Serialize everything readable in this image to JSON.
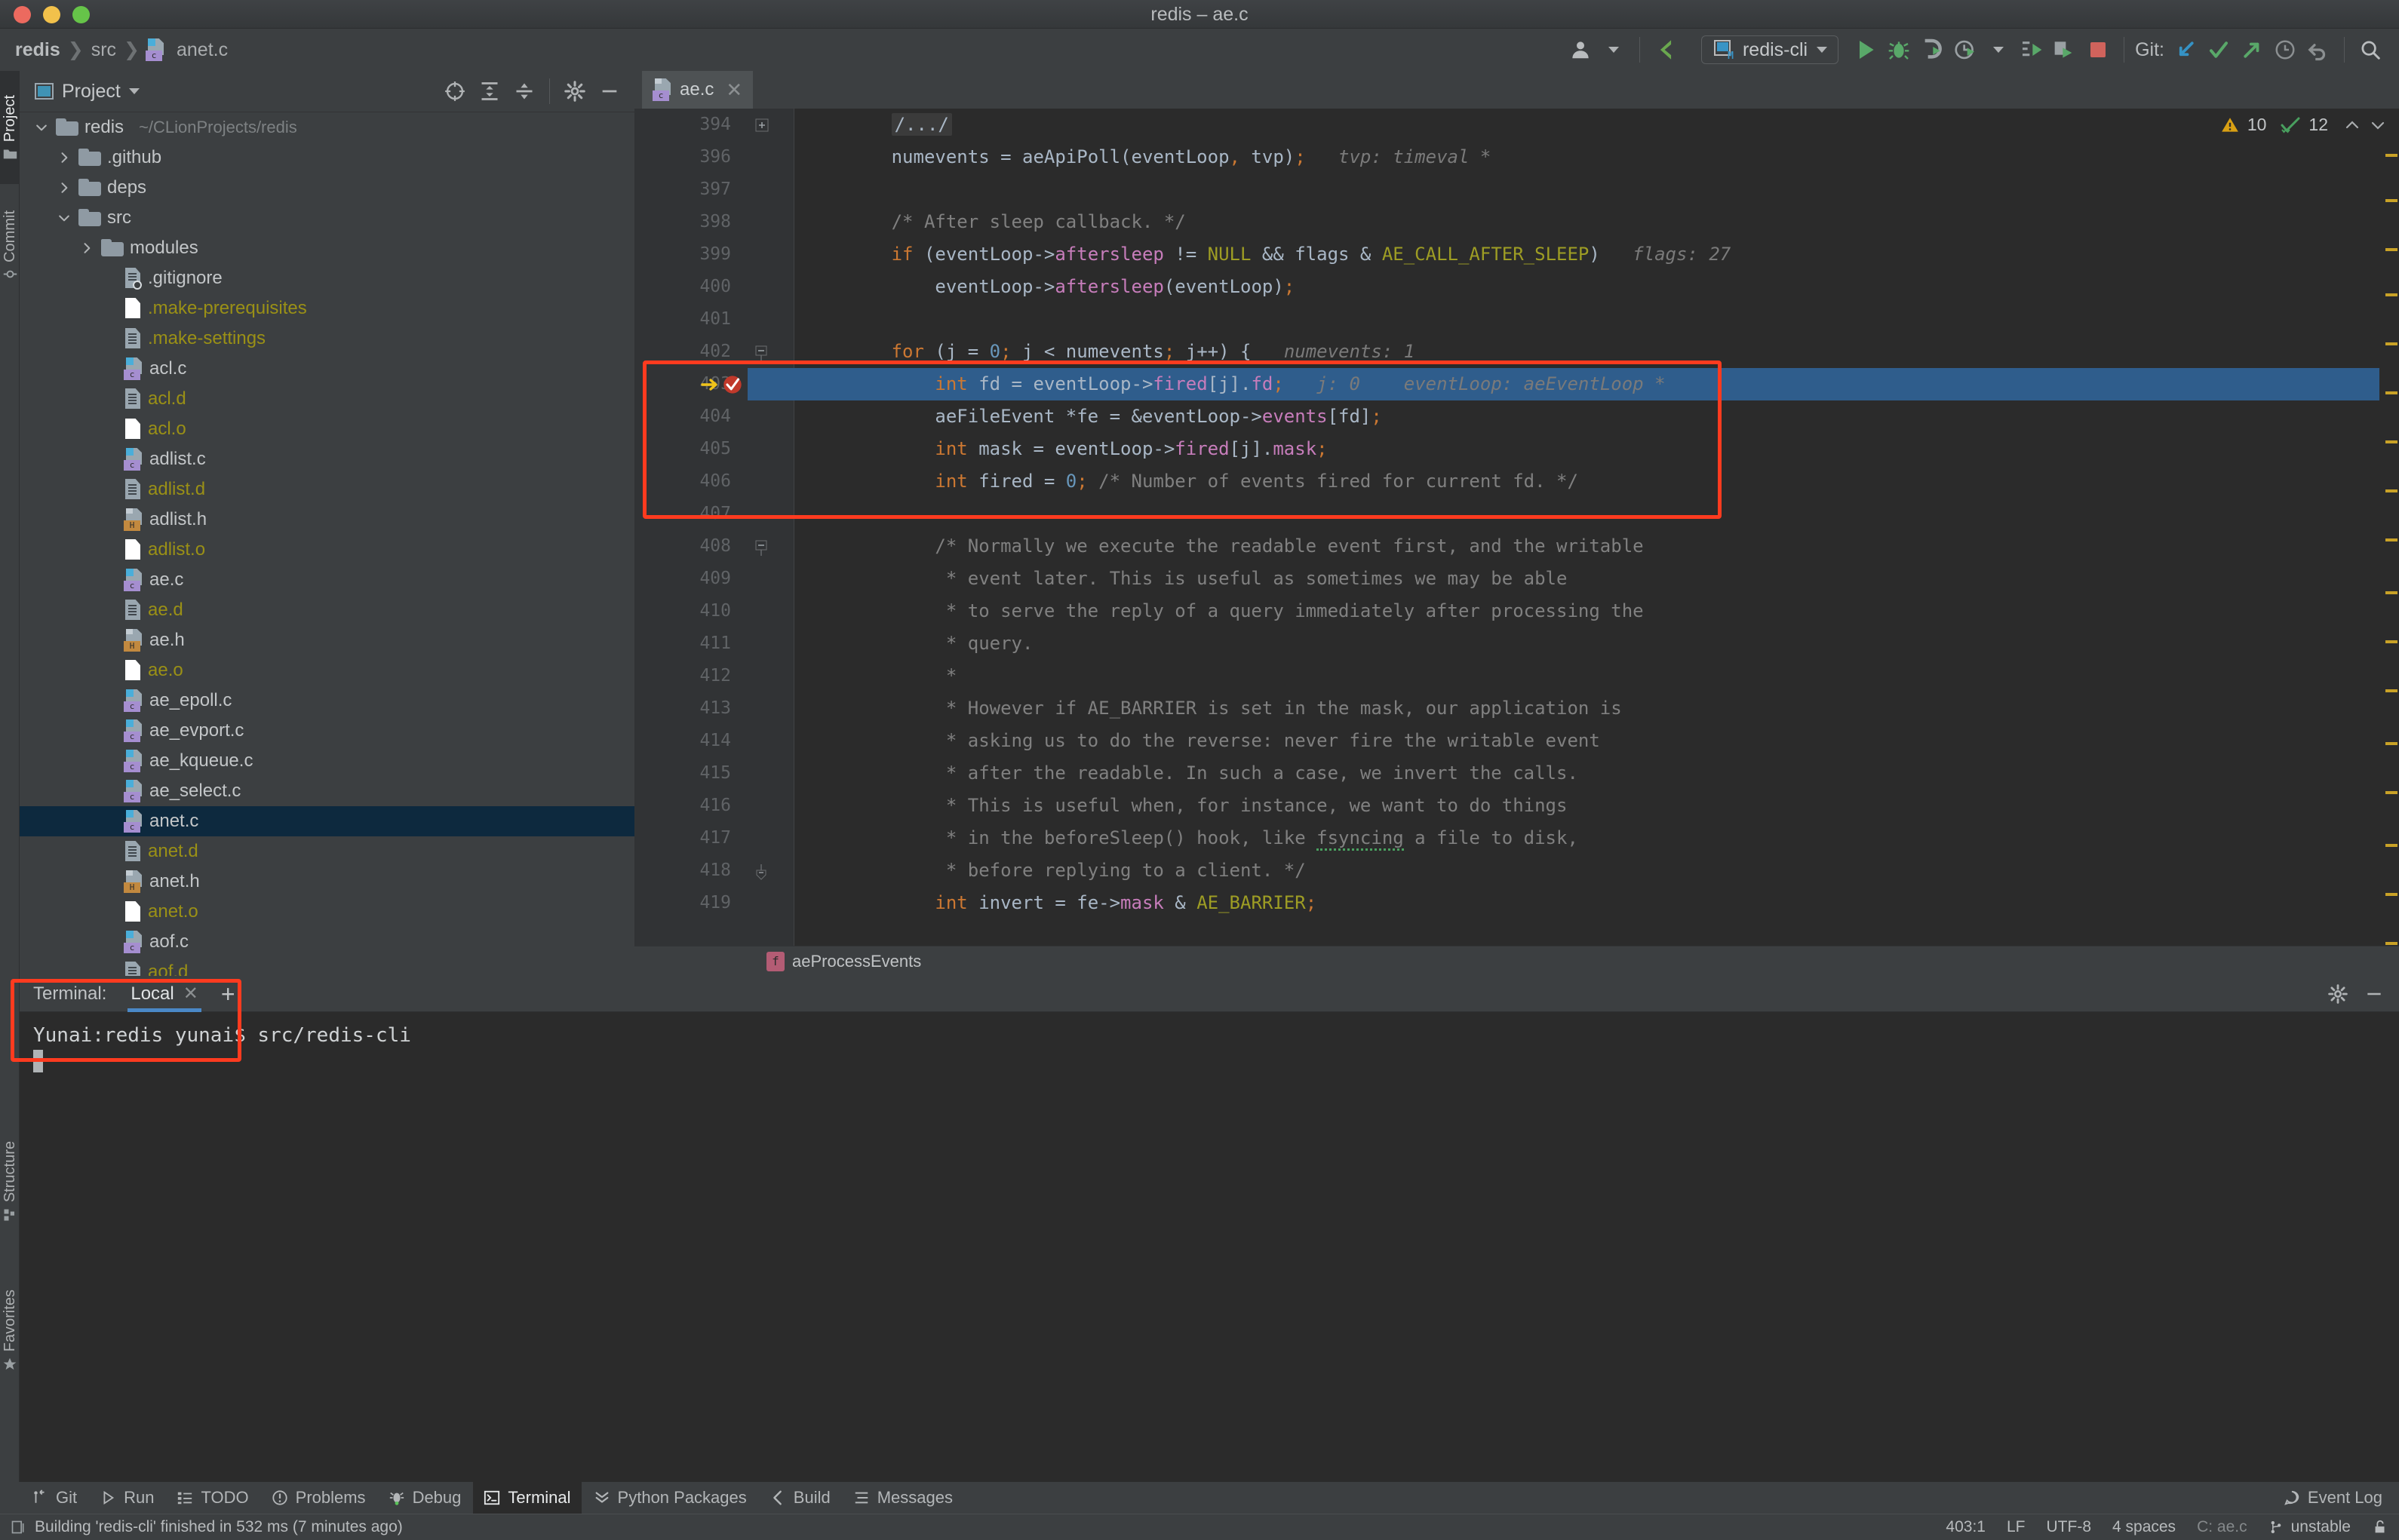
{
  "window": {
    "title": "redis – ae.c"
  },
  "breadcrumb": {
    "project": "redis",
    "folder": "src",
    "file": "anet.c",
    "separator": "❯"
  },
  "toolbar": {
    "avatar_icon": "user-avatar-icon",
    "build_icon": "build-hammer-icon",
    "run_config_label": "redis-cli",
    "run_icon": "run-play-icon",
    "debug_icon": "debug-bug-icon",
    "attach_icon": "attach-process-icon",
    "profile_icon": "profiler-clock-icon",
    "coverage_icon": "run-coverage-icon",
    "more_run_icon": "run-with-icon",
    "stop_icon": "stop-square-icon",
    "git_label": "Git:",
    "git_update_icon": "git-update-icon",
    "git_commit_icon": "git-commit-check-icon",
    "git_push_icon": "git-push-icon",
    "git_history_icon": "git-history-clock-icon",
    "git_rollback_icon": "git-rollback-icon",
    "search_icon": "search-icon"
  },
  "left_rail": {
    "top": [
      {
        "label": "Project",
        "icon": "folder-icon",
        "active": true
      },
      {
        "label": "Commit",
        "icon": "commit-icon",
        "active": false
      }
    ],
    "bottom": [
      {
        "label": "Structure",
        "icon": "structure-icon",
        "active": false
      },
      {
        "label": "Favorites",
        "icon": "star-icon",
        "active": false
      }
    ]
  },
  "project_panel": {
    "title": "Project",
    "title_icon": "project-window-icon",
    "header_icons": [
      "scroll-from-source-icon",
      "expand-all-icon",
      "collapse-all-icon",
      "settings-gear-icon",
      "hide-panel-icon"
    ],
    "tree": [
      {
        "label": "redis",
        "path": "~/CLionProjects/redis",
        "icon": "folder-icon",
        "indent": 0,
        "arrow": "down",
        "selected": false,
        "ignored": false
      },
      {
        "label": ".github",
        "path": "",
        "icon": "folder-icon",
        "indent": 1,
        "arrow": "right",
        "selected": false,
        "ignored": false
      },
      {
        "label": "deps",
        "path": "",
        "icon": "folder-icon",
        "indent": 1,
        "arrow": "right",
        "selected": false,
        "ignored": false
      },
      {
        "label": "src",
        "path": "",
        "icon": "folder-icon",
        "indent": 1,
        "arrow": "down",
        "selected": false,
        "ignored": false
      },
      {
        "label": "modules",
        "path": "",
        "icon": "folder-icon",
        "indent": 2,
        "arrow": "right",
        "selected": false,
        "ignored": false
      },
      {
        "label": ".gitignore",
        "path": "",
        "icon": "gitignore-icon",
        "indent": 3,
        "arrow": "none",
        "selected": false,
        "ignored": false
      },
      {
        "label": ".make-prerequisites",
        "path": "",
        "icon": "plain-file-icon",
        "indent": 3,
        "arrow": "none",
        "selected": false,
        "ignored": true
      },
      {
        "label": ".make-settings",
        "path": "",
        "icon": "text-file-icon",
        "indent": 3,
        "arrow": "none",
        "selected": false,
        "ignored": true
      },
      {
        "label": "acl.c",
        "path": "",
        "icon": "c-file-icon",
        "indent": 3,
        "arrow": "none",
        "selected": false,
        "ignored": false
      },
      {
        "label": "acl.d",
        "path": "",
        "icon": "text-file-icon",
        "indent": 3,
        "arrow": "none",
        "selected": false,
        "ignored": true
      },
      {
        "label": "acl.o",
        "path": "",
        "icon": "plain-file-icon",
        "indent": 3,
        "arrow": "none",
        "selected": false,
        "ignored": true
      },
      {
        "label": "adlist.c",
        "path": "",
        "icon": "c-file-icon",
        "indent": 3,
        "arrow": "none",
        "selected": false,
        "ignored": false
      },
      {
        "label": "adlist.d",
        "path": "",
        "icon": "text-file-icon",
        "indent": 3,
        "arrow": "none",
        "selected": false,
        "ignored": true
      },
      {
        "label": "adlist.h",
        "path": "",
        "icon": "h-file-icon",
        "indent": 3,
        "arrow": "none",
        "selected": false,
        "ignored": false
      },
      {
        "label": "adlist.o",
        "path": "",
        "icon": "plain-file-icon",
        "indent": 3,
        "arrow": "none",
        "selected": false,
        "ignored": true
      },
      {
        "label": "ae.c",
        "path": "",
        "icon": "c-file-icon",
        "indent": 3,
        "arrow": "none",
        "selected": false,
        "ignored": false
      },
      {
        "label": "ae.d",
        "path": "",
        "icon": "text-file-icon",
        "indent": 3,
        "arrow": "none",
        "selected": false,
        "ignored": true
      },
      {
        "label": "ae.h",
        "path": "",
        "icon": "h-file-icon",
        "indent": 3,
        "arrow": "none",
        "selected": false,
        "ignored": false
      },
      {
        "label": "ae.o",
        "path": "",
        "icon": "plain-file-icon",
        "indent": 3,
        "arrow": "none",
        "selected": false,
        "ignored": true
      },
      {
        "label": "ae_epoll.c",
        "path": "",
        "icon": "c-file-icon",
        "indent": 3,
        "arrow": "none",
        "selected": false,
        "ignored": false
      },
      {
        "label": "ae_evport.c",
        "path": "",
        "icon": "c-file-icon",
        "indent": 3,
        "arrow": "none",
        "selected": false,
        "ignored": false
      },
      {
        "label": "ae_kqueue.c",
        "path": "",
        "icon": "c-file-icon",
        "indent": 3,
        "arrow": "none",
        "selected": false,
        "ignored": false
      },
      {
        "label": "ae_select.c",
        "path": "",
        "icon": "c-file-icon",
        "indent": 3,
        "arrow": "none",
        "selected": false,
        "ignored": false
      },
      {
        "label": "anet.c",
        "path": "",
        "icon": "c-file-icon",
        "indent": 3,
        "arrow": "none",
        "selected": true,
        "ignored": false
      },
      {
        "label": "anet.d",
        "path": "",
        "icon": "text-file-icon",
        "indent": 3,
        "arrow": "none",
        "selected": false,
        "ignored": true
      },
      {
        "label": "anet.h",
        "path": "",
        "icon": "h-file-icon",
        "indent": 3,
        "arrow": "none",
        "selected": false,
        "ignored": false
      },
      {
        "label": "anet.o",
        "path": "",
        "icon": "plain-file-icon",
        "indent": 3,
        "arrow": "none",
        "selected": false,
        "ignored": true
      },
      {
        "label": "aof.c",
        "path": "",
        "icon": "c-file-icon",
        "indent": 3,
        "arrow": "none",
        "selected": false,
        "ignored": false
      },
      {
        "label": "aof.d",
        "path": "",
        "icon": "text-file-icon",
        "indent": 3,
        "arrow": "none",
        "selected": false,
        "ignored": true
      }
    ]
  },
  "editor": {
    "tab": {
      "label": "ae.c",
      "icon": "c-file-icon",
      "close_icon": "close-icon"
    },
    "inspections": {
      "warning_icon": "warning-triangle-icon",
      "warning_count": "10",
      "weak_warning_icon": "green-check-icon",
      "weak_warning_count": "12",
      "prev_icon": "chevron-up-icon",
      "next_icon": "chevron-down-icon"
    },
    "breadcrumb_function": "aeProcessEvents",
    "breadcrumb_icon": "function-icon",
    "current_line": 403,
    "lines": [
      {
        "n": 394,
        "fold": "plus",
        "segs": [
          {
            "t": "        ",
            "c": ""
          },
          {
            "t": "/.../",
            "c": "folded"
          }
        ]
      },
      {
        "n": 396,
        "fold": "",
        "segs": [
          {
            "t": "        numevents ",
            "c": "dim"
          },
          {
            "t": "=",
            "c": "dim"
          },
          {
            "t": " aeApiPoll(eventLoop",
            "c": "dim"
          },
          {
            "t": ",",
            "c": "kw"
          },
          {
            "t": " tvp)",
            "c": "dim"
          },
          {
            "t": ";",
            "c": "kw"
          },
          {
            "t": "   tvp: timeval *",
            "c": "hint"
          }
        ]
      },
      {
        "n": 397,
        "fold": "",
        "segs": []
      },
      {
        "n": 398,
        "fold": "",
        "segs": [
          {
            "t": "        /* After sleep callback. */",
            "c": "cmt"
          }
        ]
      },
      {
        "n": 399,
        "fold": "",
        "segs": [
          {
            "t": "        ",
            "c": ""
          },
          {
            "t": "if",
            "c": "kw"
          },
          {
            "t": " (eventLoop->",
            "c": "dim"
          },
          {
            "t": "aftersleep",
            "c": "fld"
          },
          {
            "t": " != ",
            "c": "dim"
          },
          {
            "t": "NULL",
            "c": "const"
          },
          {
            "t": " && flags & ",
            "c": "dim"
          },
          {
            "t": "AE_CALL_AFTER_SLEEP",
            "c": "const"
          },
          {
            "t": ")",
            "c": "dim"
          },
          {
            "t": "   flags: 27",
            "c": "hint"
          }
        ]
      },
      {
        "n": 400,
        "fold": "",
        "segs": [
          {
            "t": "            eventLoop->",
            "c": "dim"
          },
          {
            "t": "aftersleep",
            "c": "fld"
          },
          {
            "t": "(eventLoop)",
            "c": "dim"
          },
          {
            "t": ";",
            "c": "kw"
          }
        ]
      },
      {
        "n": 401,
        "fold": "",
        "segs": []
      },
      {
        "n": 402,
        "fold": "minus",
        "segs": [
          {
            "t": "        ",
            "c": ""
          },
          {
            "t": "for",
            "c": "kw"
          },
          {
            "t": " (j = ",
            "c": "dim"
          },
          {
            "t": "0",
            "c": "num"
          },
          {
            "t": ";",
            "c": "kw"
          },
          {
            "t": " j < numevents",
            "c": "dim"
          },
          {
            "t": ";",
            "c": "kw"
          },
          {
            "t": " j++) {",
            "c": "dim"
          },
          {
            "t": "   numevents: 1",
            "c": "hint"
          }
        ]
      },
      {
        "n": 403,
        "fold": "",
        "highlight": true,
        "exec": true,
        "breakpoint": true,
        "segs": [
          {
            "t": "            ",
            "c": ""
          },
          {
            "t": "int",
            "c": "kw"
          },
          {
            "t": " fd = eventLoop->",
            "c": "dim"
          },
          {
            "t": "fired",
            "c": "fld"
          },
          {
            "t": "[j].",
            "c": "dim"
          },
          {
            "t": "fd",
            "c": "fld"
          },
          {
            "t": ";",
            "c": "kw"
          },
          {
            "t": "   j: 0    eventLoop: aeEventLoop *",
            "c": "hint"
          }
        ]
      },
      {
        "n": 404,
        "fold": "",
        "segs": [
          {
            "t": "            aeFileEvent *fe = &eventLoop->",
            "c": "dim"
          },
          {
            "t": "events",
            "c": "fld"
          },
          {
            "t": "[fd]",
            "c": "dim"
          },
          {
            "t": ";",
            "c": "kw"
          }
        ]
      },
      {
        "n": 405,
        "fold": "",
        "segs": [
          {
            "t": "            ",
            "c": ""
          },
          {
            "t": "int",
            "c": "kw"
          },
          {
            "t": " mask = eventLoop->",
            "c": "dim"
          },
          {
            "t": "fired",
            "c": "fld"
          },
          {
            "t": "[j].",
            "c": "dim"
          },
          {
            "t": "mask",
            "c": "fld"
          },
          {
            "t": ";",
            "c": "kw"
          }
        ]
      },
      {
        "n": 406,
        "fold": "",
        "segs": [
          {
            "t": "            ",
            "c": ""
          },
          {
            "t": "int",
            "c": "kw"
          },
          {
            "t": " fired = ",
            "c": "dim"
          },
          {
            "t": "0",
            "c": "num"
          },
          {
            "t": ";",
            "c": "kw"
          },
          {
            "t": " /* Number of events fired for current fd. */",
            "c": "cmt"
          }
        ]
      },
      {
        "n": 407,
        "fold": "",
        "segs": []
      },
      {
        "n": 408,
        "fold": "minus",
        "segs": [
          {
            "t": "            /* Normally we execute the readable event first, and the writable",
            "c": "cmt"
          }
        ]
      },
      {
        "n": 409,
        "fold": "",
        "segs": [
          {
            "t": "             * event later. This is useful as sometimes we may be able",
            "c": "cmt"
          }
        ]
      },
      {
        "n": 410,
        "fold": "",
        "segs": [
          {
            "t": "             * to serve the reply of a query immediately after processing the",
            "c": "cmt"
          }
        ]
      },
      {
        "n": 411,
        "fold": "",
        "segs": [
          {
            "t": "             * query.",
            "c": "cmt"
          }
        ]
      },
      {
        "n": 412,
        "fold": "",
        "segs": [
          {
            "t": "             *",
            "c": "cmt"
          }
        ]
      },
      {
        "n": 413,
        "fold": "",
        "segs": [
          {
            "t": "             * However if AE_BARRIER is set in the mask, our application is",
            "c": "cmt"
          }
        ]
      },
      {
        "n": 414,
        "fold": "",
        "segs": [
          {
            "t": "             * asking us to do the reverse: never fire the writable event",
            "c": "cmt"
          }
        ]
      },
      {
        "n": 415,
        "fold": "",
        "segs": [
          {
            "t": "             * after the readable. In such a case, we invert the calls.",
            "c": "cmt"
          }
        ]
      },
      {
        "n": 416,
        "fold": "",
        "segs": [
          {
            "t": "             * This is useful when, for instance, we want to do things",
            "c": "cmt"
          }
        ]
      },
      {
        "n": 417,
        "fold": "",
        "segs": [
          {
            "t": "             * in the beforeSleep() hook, like ",
            "c": "cmt"
          },
          {
            "t": "fsyncing",
            "c": "cmt spell"
          },
          {
            "t": " a file to disk,",
            "c": "cmt"
          }
        ]
      },
      {
        "n": 418,
        "fold": "minus-end",
        "segs": [
          {
            "t": "             * before replying to a client. */",
            "c": "cmt"
          }
        ]
      },
      {
        "n": 419,
        "fold": "",
        "segs": [
          {
            "t": "            ",
            "c": ""
          },
          {
            "t": "int",
            "c": "kw"
          },
          {
            "t": " invert = fe->",
            "c": "dim"
          },
          {
            "t": "mask",
            "c": "fld"
          },
          {
            "t": " & ",
            "c": "dim"
          },
          {
            "t": "AE_BARRIER",
            "c": "const"
          },
          {
            "t": ";",
            "c": "kw"
          }
        ]
      }
    ]
  },
  "terminal": {
    "label": "Terminal:",
    "tab_label": "Local",
    "close_icon": "close-icon",
    "add_icon": "add-tab-icon",
    "settings_icon": "settings-gear-icon",
    "hide_icon": "hide-panel-icon",
    "lines": [
      "Yunai:redis yunai$ src/redis-cli"
    ]
  },
  "bottom_tabs": [
    {
      "label": "Git",
      "icon": "git-branch-icon",
      "active": false
    },
    {
      "label": "Run",
      "icon": "run-play-icon",
      "active": false
    },
    {
      "label": "TODO",
      "icon": "todo-list-icon",
      "active": false
    },
    {
      "label": "Problems",
      "icon": "problems-icon",
      "active": false
    },
    {
      "label": "Debug",
      "icon": "debug-bug-icon",
      "active": false
    },
    {
      "label": "Terminal",
      "icon": "terminal-icon",
      "active": true
    },
    {
      "label": "Python Packages",
      "icon": "python-packages-icon",
      "active": false
    },
    {
      "label": "Build",
      "icon": "build-hammer-icon",
      "active": false
    },
    {
      "label": "Messages",
      "icon": "messages-icon",
      "active": false
    }
  ],
  "event_log": {
    "label": "Event Log",
    "icon": "event-log-icon"
  },
  "status_bar": {
    "message": "Building 'redis-cli' finished in 532 ms (7 minutes ago)",
    "message_icon": "build-status-icon",
    "caret_position": "403:1",
    "line_separator": "LF",
    "encoding": "UTF-8",
    "indent": "4 spaces",
    "context": "C: ae.c",
    "branch": "unstable",
    "branch_icon": "git-branch-icon",
    "lock_icon": "read-only-lock-icon"
  },
  "colors": {
    "accent_blue": "#4a88c7",
    "selection_blue": "#2f5d8c",
    "tree_selection": "#0d293e",
    "annotation_red": "#ff3b1f",
    "keyword_orange": "#cc7832",
    "field_purple": "#c77dbb",
    "constant_olive": "#9e9d24",
    "comment_gray": "#808080",
    "number_blue": "#6897bb",
    "editor_bg": "#2b2b2b",
    "panel_bg": "#3c3f41"
  }
}
